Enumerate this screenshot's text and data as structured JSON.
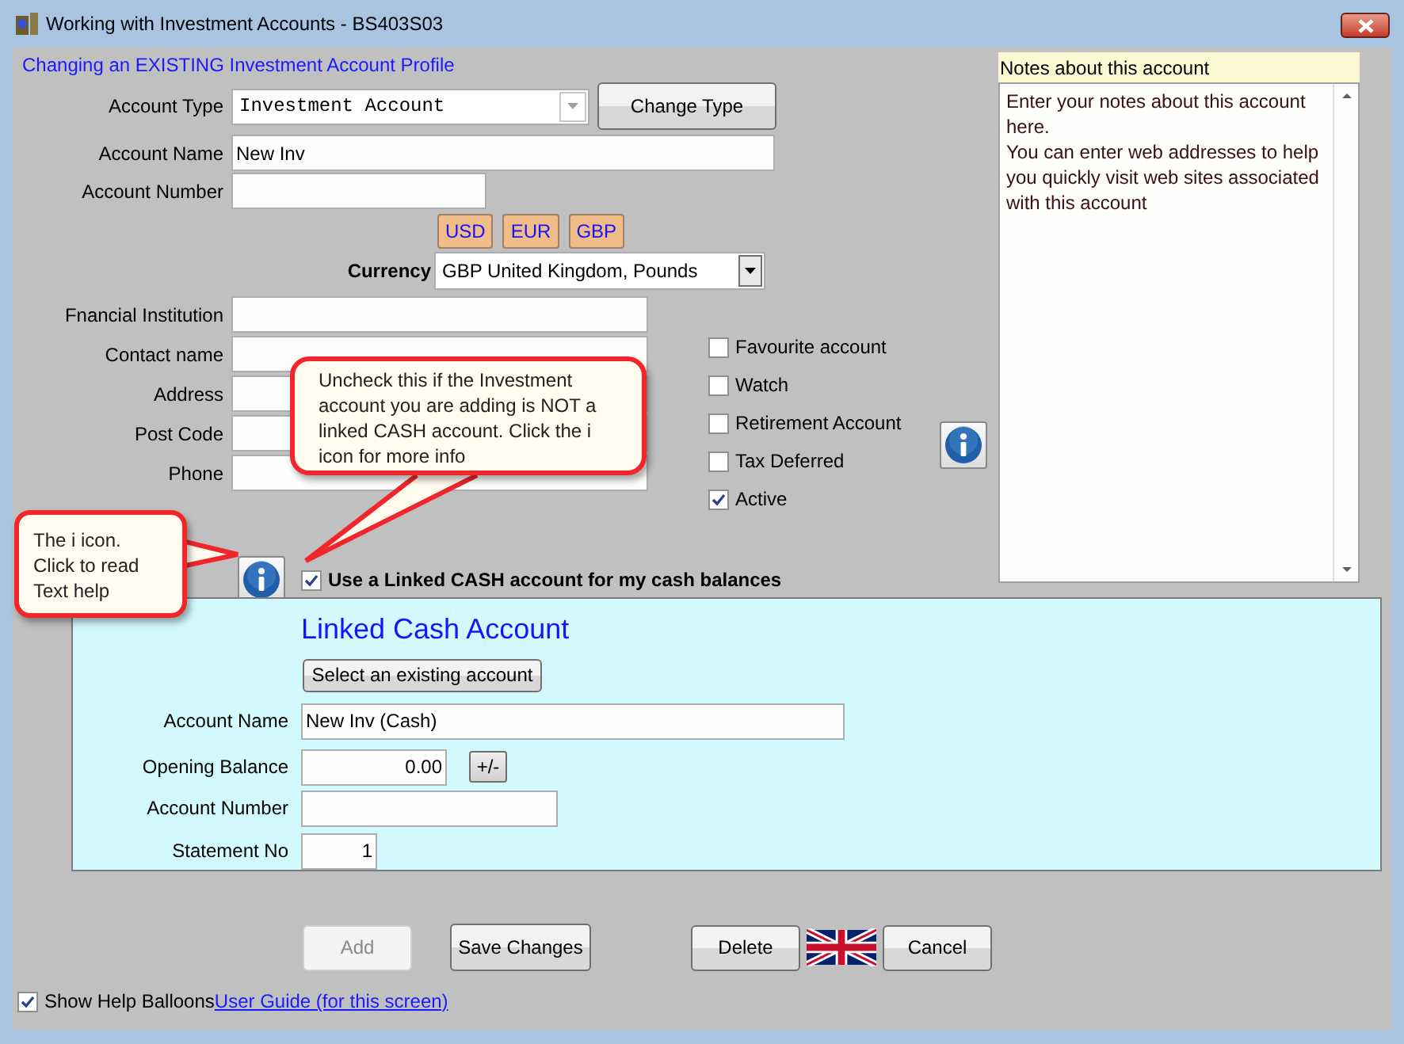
{
  "window": {
    "title": "Working with Investment Accounts - BS403S03"
  },
  "heading": "Changing an EXISTING Investment Account Profile",
  "account_type": {
    "label": "Account Type",
    "value": "Investment Account"
  },
  "change_type_button": "Change Type",
  "account_name": {
    "label": "Account Name",
    "value": "New Inv"
  },
  "account_number": {
    "label": "Account Number"
  },
  "currency_buttons": [
    "USD",
    "EUR",
    "GBP"
  ],
  "currency": {
    "label": "Currency",
    "value": "GBP United Kingdom, Pounds"
  },
  "contact_fields": [
    {
      "label": "Fnancial Institution"
    },
    {
      "label": "Contact name"
    },
    {
      "label": "Address"
    },
    {
      "label": "Post Code"
    },
    {
      "label": "Phone"
    }
  ],
  "flags": [
    {
      "label": "Favourite account",
      "checked": false
    },
    {
      "label": "Watch",
      "checked": false
    },
    {
      "label": "Retirement Account",
      "checked": false
    },
    {
      "label": "Tax Deferred",
      "checked": false
    },
    {
      "label": "Active",
      "checked": true
    }
  ],
  "linked_cash_toggle": {
    "label": "Use a Linked CASH account for my cash balances",
    "checked": true
  },
  "balloons": [
    {
      "text": "Uncheck this if the Investment account you are adding is NOT a linked CASH account. Click the i icon for more info"
    },
    {
      "text": "The i icon. Click to read Text help"
    }
  ],
  "notes": {
    "title": "Notes about this account",
    "paragraphs": [
      "Enter your notes about this account here.",
      "You can enter web addresses to help you quickly visit web sites associated with this account"
    ]
  },
  "linked_cash": {
    "title": "Linked Cash Account",
    "select_button": "Select an existing account",
    "fields": [
      {
        "kind": "text",
        "label": "Account Name",
        "value": "New Inv (Cash)"
      },
      {
        "kind": "amount",
        "label": "Opening Balance",
        "value": "0.00",
        "sign_button": "+/-"
      },
      {
        "kind": "text",
        "label": "Account Number"
      },
      {
        "kind": "counter",
        "label": "Statement No",
        "value": "1"
      }
    ]
  },
  "buttons": [
    {
      "label": "Add",
      "disabled": true
    },
    {
      "label": "Save Changes",
      "disabled": false
    },
    {
      "label": "Delete",
      "disabled": false
    },
    {
      "label": "Cancel",
      "disabled": false
    }
  ],
  "show_help": {
    "label": "Show Help Balloons",
    "checked": true
  },
  "user_guide_link": "User Guide (for this screen)"
}
